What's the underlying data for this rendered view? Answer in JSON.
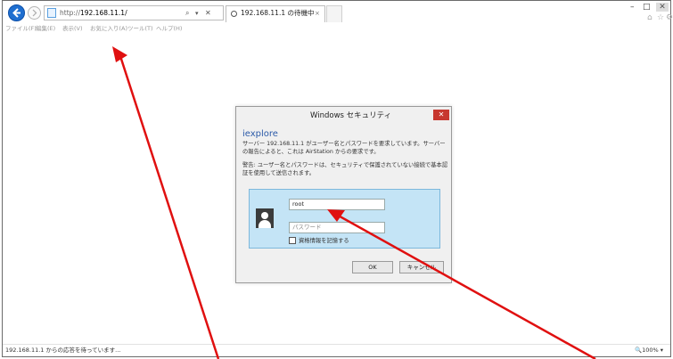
{
  "browser": {
    "url_prefix": "http://",
    "url_host": "192.168.11.1/",
    "search_glyph": "⌕",
    "dropdown_glyph": "▾",
    "stop_glyph": "✕",
    "tab_label": "192.168.11.1 の待機中",
    "tab_close": "×",
    "menu": [
      "ファイル(F)",
      "編集(E)",
      "表示(V)",
      "お気に入り(A)",
      "ツール(T)",
      "ヘルプ(H)"
    ],
    "status_text": "192.168.11.1 からの応答を待っています...",
    "zoom": "🔍100%  ▾"
  },
  "dialog": {
    "title": "Windows セキュリティ",
    "close_glyph": "✕",
    "app_name": "iexplore",
    "message1": "サーバー 192.168.11.1 がユーザー名とパスワードを要求しています。サーバーの報告によると、これは AirStation からの要求です。",
    "message2": "警告: ユーザー名とパスワードは、セキュリティで保護されていない接続で基本認証を使用して送信されます。",
    "username_value": "root",
    "password_placeholder": "パスワード",
    "remember_label": "資格情報を記憶する",
    "ok_label": "OK",
    "cancel_label": "キャンセル"
  },
  "colors": {
    "accent_blue": "#1f6fd0",
    "credential_panel": "#c4e4f6",
    "close_red": "#c7372f",
    "annotation_red": "#e01010"
  }
}
